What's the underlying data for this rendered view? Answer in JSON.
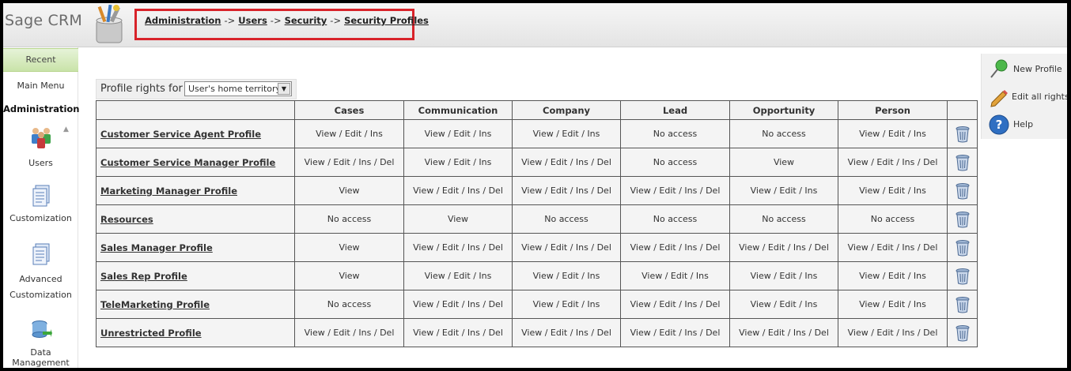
{
  "app": {
    "brand": "Sage CRM"
  },
  "breadcrumb": [
    {
      "label": "Administration"
    },
    {
      "label": "Users"
    },
    {
      "label": "Security"
    },
    {
      "label": "Security Profiles"
    }
  ],
  "breadcrumb_separator": "->",
  "sidebar": {
    "recent": "Recent",
    "main_menu": "Main Menu",
    "section_title": "Administration",
    "items": [
      {
        "label": "Users",
        "icon": "users-icon"
      },
      {
        "label": "Customization",
        "icon": "customization-icon"
      },
      {
        "label": "Advanced Customization",
        "line1": "Advanced",
        "line2": "Customization",
        "icon": "advanced-customization-icon"
      },
      {
        "label": "Data Management",
        "icon": "data-management-icon"
      }
    ]
  },
  "filter": {
    "label": "Profile rights for",
    "selected": "User's home territory"
  },
  "table": {
    "columns": [
      "",
      "Cases",
      "Communication",
      "Company",
      "Lead",
      "Opportunity",
      "Person",
      ""
    ],
    "rows": [
      {
        "name": "Customer Service Agent Profile",
        "cells": [
          "View / Edit / Ins",
          "View / Edit / Ins",
          "View / Edit / Ins",
          "No access",
          "No access",
          "View / Edit / Ins"
        ]
      },
      {
        "name": "Customer Service Manager Profile",
        "cells": [
          "View / Edit / Ins / Del",
          "View / Edit / Ins",
          "View / Edit / Ins / Del",
          "No access",
          "View",
          "View / Edit / Ins / Del"
        ]
      },
      {
        "name": "Marketing Manager Profile",
        "cells": [
          "View",
          "View / Edit / Ins / Del",
          "View / Edit / Ins / Del",
          "View / Edit / Ins / Del",
          "View / Edit / Ins",
          "View / Edit / Ins"
        ]
      },
      {
        "name": "Resources",
        "cells": [
          "No access",
          "View",
          "No access",
          "No access",
          "No access",
          "No access"
        ]
      },
      {
        "name": "Sales Manager Profile",
        "cells": [
          "View",
          "View / Edit / Ins / Del",
          "View / Edit / Ins / Del",
          "View / Edit / Ins / Del",
          "View / Edit / Ins / Del",
          "View / Edit / Ins / Del"
        ]
      },
      {
        "name": "Sales Rep Profile",
        "cells": [
          "View",
          "View / Edit / Ins",
          "View / Edit / Ins",
          "View / Edit / Ins",
          "View / Edit / Ins",
          "View / Edit / Ins"
        ]
      },
      {
        "name": "TeleMarketing Profile",
        "cells": [
          "No access",
          "View / Edit / Ins / Del",
          "View / Edit / Ins",
          "View / Edit / Ins / Del",
          "View / Edit / Ins",
          "View / Edit / Ins"
        ]
      },
      {
        "name": "Unrestricted Profile",
        "cells": [
          "View / Edit / Ins / Del",
          "View / Edit / Ins / Del",
          "View / Edit / Ins / Del",
          "View / Edit / Ins / Del",
          "View / Edit / Ins / Del",
          "View / Edit / Ins / Del"
        ]
      }
    ]
  },
  "actions": [
    {
      "label": "New Profile",
      "icon": "pushpin-icon"
    },
    {
      "label": "Edit all rights",
      "icon": "pencil-icon"
    },
    {
      "label": "Help",
      "icon": "help-icon"
    }
  ],
  "colors": {
    "breadcrumb_highlight": "#d8232a",
    "recent_bg": "#c9e3a9"
  }
}
